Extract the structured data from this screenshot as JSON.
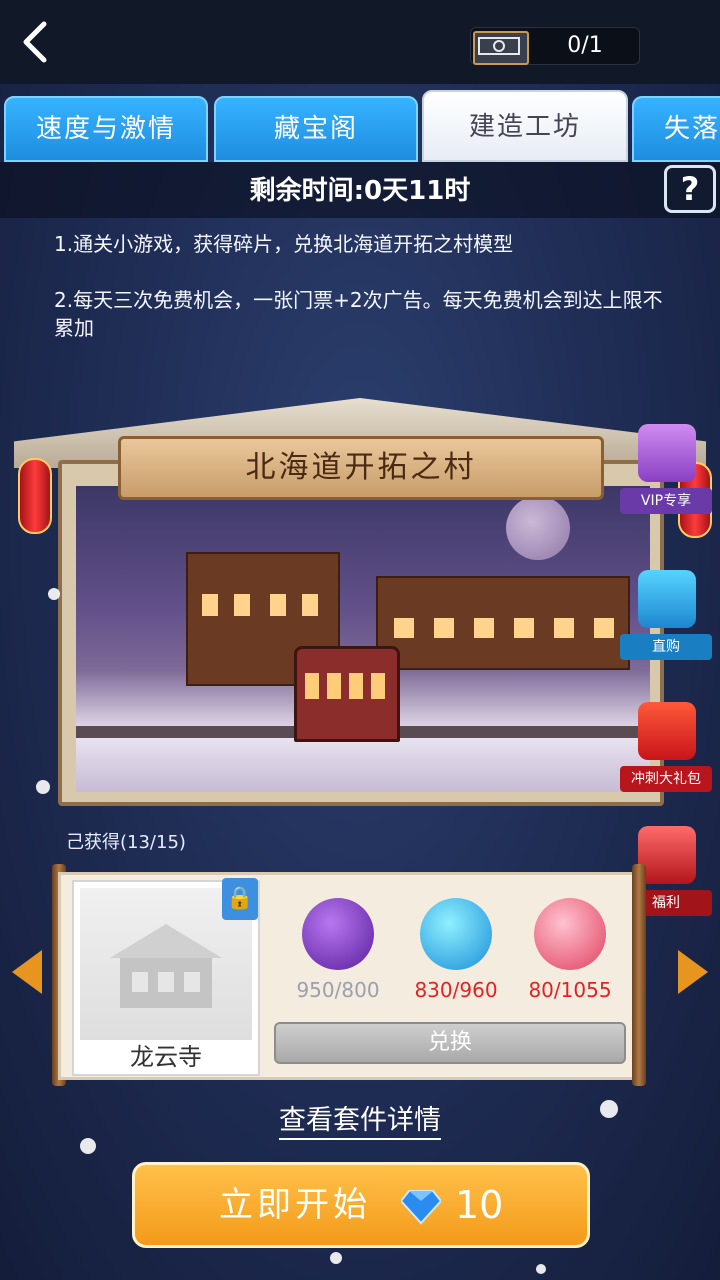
{
  "header": {
    "ticket_count": "0/1"
  },
  "tabs": [
    {
      "label": "速度与激情",
      "active": false
    },
    {
      "label": "藏宝阁",
      "active": false
    },
    {
      "label": "建造工坊",
      "active": true
    },
    {
      "label": "失落",
      "active": false
    }
  ],
  "event": {
    "remaining_time": "剩余时间:0天11时",
    "help_label": "?",
    "rule1": "1.通关小游戏，获得碎片，兑换北海道开拓之村模型",
    "rule2": "2.每天三次免费机会，一张门票+2次广告。每天免费机会到达上限不累加"
  },
  "stage": {
    "title": "北海道开拓之村"
  },
  "side_buttons": [
    {
      "label": "VIP专享",
      "icon": "vip-gift-icon",
      "color": "#a45bd8"
    },
    {
      "label": "直购",
      "icon": "direct-buy-gift-icon",
      "color": "#2aa6e0"
    },
    {
      "label": "冲刺大礼包",
      "icon": "sprint-gift-icon",
      "color": "#e0302a"
    },
    {
      "label": "福利",
      "icon": "welfare-gift-icon",
      "color": "#c4262a"
    }
  ],
  "collection": {
    "obtained": "己获得(13/15)",
    "item_name": "龙云寺",
    "resources": [
      {
        "icon": "moon-icon",
        "value": "950/800",
        "status_color": "#9aa0ae"
      },
      {
        "icon": "snowflake-icon",
        "value": "830/960",
        "status_color": "#e22222"
      },
      {
        "icon": "sakura-icon",
        "value": "80/1055",
        "status_color": "#e22222"
      }
    ],
    "exchange_label": "兑换"
  },
  "details_link": "查看套件详情",
  "start": {
    "label": "立即开始",
    "cost": "10"
  },
  "colors": {
    "accent": "#f39a1a",
    "tab_blue": "#2a9cf0"
  }
}
